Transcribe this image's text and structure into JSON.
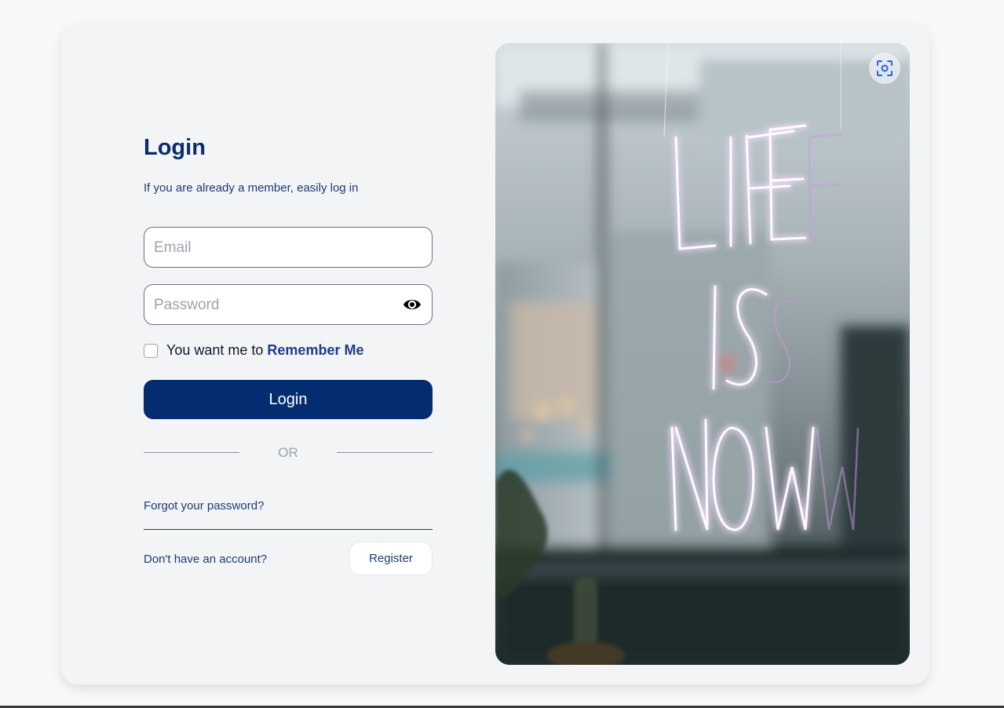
{
  "login": {
    "title": "Login",
    "subtitle": "If you are already a member, easily log in",
    "email_placeholder": "Email",
    "password_placeholder": "Password",
    "remember_prefix": "You want me to",
    "remember_emphasis": "Remember Me",
    "login_button": "Login",
    "divider_text": "OR",
    "forgot_link": "Forgot your password?",
    "no_account_text": "Don't have an account?",
    "register_button": "Register"
  },
  "image": {
    "neon_sign_text": "LIFE IS NOW",
    "scan_button_icon": "visual-search-icon",
    "password_toggle_icon": "eye-icon"
  },
  "colors": {
    "primary": "#042c71",
    "heading": "#0b2c6b",
    "text": "#1f3a73",
    "neon": "#e9c6ff"
  }
}
